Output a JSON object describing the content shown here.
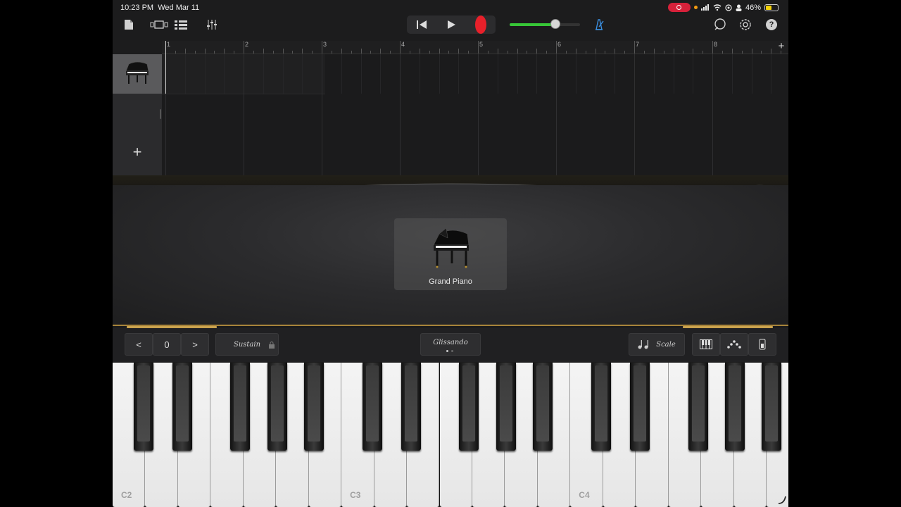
{
  "status_bar": {
    "time": "10:23 PM",
    "date": "Wed Mar 11",
    "battery": "46%"
  },
  "toolbar": {
    "left_icons": [
      "document-icon",
      "view-toggle-icon",
      "tracks-view-icon",
      "mixer-icon"
    ],
    "right_icons": [
      "loop-icon",
      "settings-icon",
      "help-icon"
    ],
    "help_label": "?"
  },
  "transport": {
    "buttons": [
      "rewind",
      "play",
      "record"
    ],
    "master_volume": 0.65
  },
  "ruler": {
    "bars": [
      "1",
      "2",
      "3",
      "4",
      "5",
      "6",
      "7",
      "8"
    ],
    "add_label": "+"
  },
  "tracks": {
    "add_track_label": "+"
  },
  "instrument": {
    "name": "Grand Piano"
  },
  "controls": {
    "octave_value": "0",
    "octave_down": "<",
    "octave_up": ">",
    "sustain_label": "Sustain",
    "glissando_label": "Glissando",
    "scale_label": "Scale"
  },
  "keyboard": {
    "labels": [
      "C2",
      "C3",
      "C4"
    ]
  },
  "colors": {
    "record": "#e8202a",
    "volume": "#37c637",
    "metronome": "#3b8fe0",
    "gold": "#c9a24e"
  }
}
